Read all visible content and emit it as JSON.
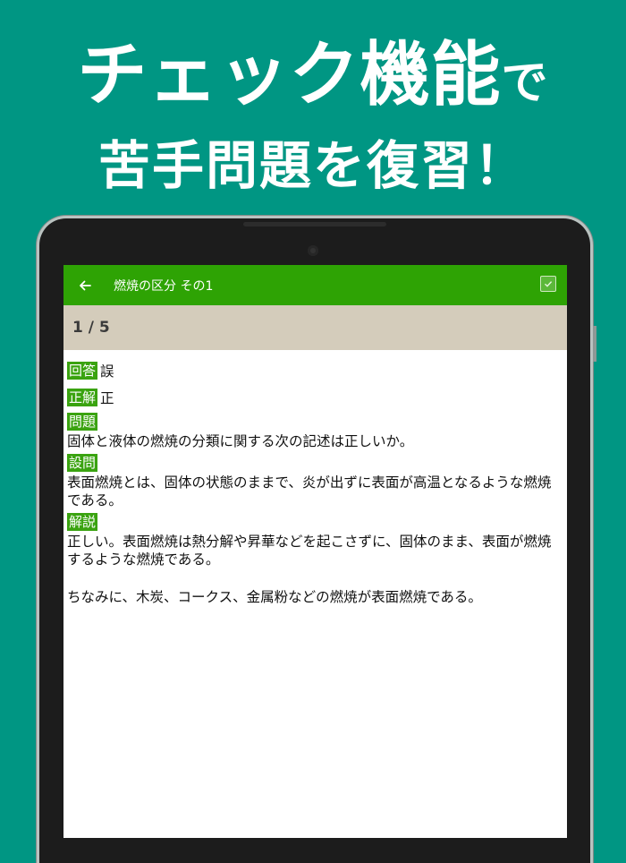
{
  "promo": {
    "line1_main": "チェック機能",
    "line1_particle": "で",
    "line2": "苦手問題を復習！"
  },
  "appbar": {
    "title": "燃焼の区分 その1",
    "check_state": "checked",
    "accent_color": "#2ea304"
  },
  "progress": {
    "text": "1 / 5"
  },
  "result": {
    "answer_tag": "回答",
    "answer_value": "誤",
    "correct_tag": "正解",
    "correct_value": "正"
  },
  "question": {
    "tag": "問題",
    "text": "固体と液体の燃焼の分類に関する次の記述は正しいか。"
  },
  "statement": {
    "tag": "設問",
    "text": "表面燃焼とは、固体の状態のままで、炎が出ずに表面が高温となるような燃焼である。"
  },
  "explanation": {
    "tag": "解説",
    "text1": "正しい。表面燃焼は熱分解や昇華などを起こさずに、固体のまま、表面が燃焼するような燃焼である。",
    "text2": "ちなみに、木炭、コークス、金属粉などの燃焼が表面燃焼である。"
  },
  "icons": {
    "back": "arrow-back-icon",
    "check": "checkbox-icon"
  },
  "colors": {
    "background": "#009683",
    "tag": "#3aa310",
    "progress_bar": "#d4ccbb"
  }
}
